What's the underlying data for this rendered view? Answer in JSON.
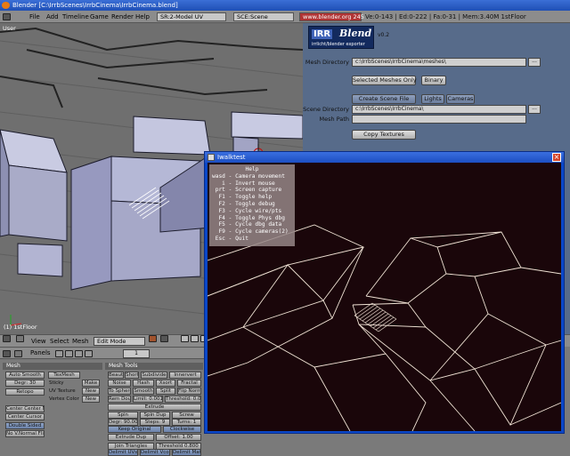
{
  "window": {
    "title": "Blender [C:\\IrrbScenes\\IrrbCinema\\IrrbCinema.blend]"
  },
  "menubar": {
    "items": [
      "File",
      "Add",
      "Timeline",
      "Game",
      "Render",
      "Help"
    ],
    "screen": "SR:2-Model UV",
    "scene": "SCE:Scene",
    "url": "www.blender.org 245",
    "stats": "Ve:0-143 | Ed:0-222 | Fa:0-31 | Mem:3.40M 1stFloor"
  },
  "viewport": {
    "corner_label": "User",
    "object_label": "(1) 1stFloor"
  },
  "irrb": {
    "logo_irr": "IRR",
    "logo_blend": "Blend",
    "logo_sub": "irrlicht/blender exporter",
    "version": "v0.2",
    "mesh_directory_label": "Mesh Directory",
    "mesh_directory_value": "c:\\IrrbScenes\\IrrbCinema\\meshes\\",
    "selected_meshes_only": "Selected Meshes Only",
    "binary": "Binary",
    "create_scene_file": "Create Scene File",
    "lights": "Lights",
    "cameras": "Cameras",
    "scene_directory_label": "Scene Directory",
    "scene_directory_value": "c:\\IrrbScenes\\IrrbCinema\\",
    "mesh_path_label": "Mesh Path",
    "copy_textures": "Copy Textures",
    "browse": "..."
  },
  "vpheader": {
    "view": "View",
    "select": "Select",
    "mesh": "Mesh",
    "mode": "Edit Mode"
  },
  "buttons": {
    "panels": "Panels",
    "page": "1",
    "mesh_title": "Mesh",
    "mesh_tools_title": "Mesh Tools",
    "auto_smooth": "Auto Smooth",
    "degr": "Degr: 30",
    "retopo": "Retopo",
    "texmesh": "TexMesh",
    "sticky": "Sticky",
    "uv_texture": "UV Texture",
    "vertex_color": "Vertex Color",
    "make": "Make",
    "new1": "New",
    "new2": "New",
    "center_cursor_new": "Center Center Ne",
    "center_cursor": "Center Cursor",
    "double_sided": "Double Sided",
    "no_v_normal_flip": "No V.Normal Flip",
    "tools": [
      "Beauty",
      "Short",
      "Subdivide",
      "Innervert",
      "Noise",
      "Hash",
      "Xsort",
      "Fractal",
      "To Sphere",
      "Smooth",
      "Split",
      "Flip Normal",
      "Rem Doubles",
      "Limit: 0.001",
      "Threshold: 0.010"
    ],
    "extrude": "Extrude",
    "spin": "Spin",
    "spin_dup": "Spin Dup",
    "screw": "Screw",
    "degr_900": "Degr: 90.00",
    "steps": "Steps: 9",
    "turns": "Turns: 1",
    "keep_original": "Keep Original",
    "clockwise": "Clockwise",
    "extrude_dup": "Extrude Dup",
    "offset": "Offset: 1.00",
    "join_triangles": "Join Triangles",
    "threshold": "Threshold 0.800",
    "delimit_uv": "Delimit UVs",
    "delimit_vcol": "Delimit Vcols",
    "delimit_mat": "Delimit Mats"
  },
  "game_window": {
    "title": "Iwalktest",
    "close": "×",
    "help_title": "Help",
    "help_lines": [
      "wasd - Camera movement",
      "   i - Invert mouse",
      " prt - Screen capture",
      "  F1 - Toggle help",
      "  F2 - Toggle debug",
      "  F3 - Cycle wire/pts",
      "  F4 - Toggle Phys dbg",
      "  F5 - Cycle dbg data",
      "  F9 - Cycle cameras(2)",
      " Esc - Quit"
    ]
  },
  "colors": {
    "irrb_panel": "#576b8a",
    "game_bg": "#1a060a",
    "wire": "#f0e6d8"
  }
}
